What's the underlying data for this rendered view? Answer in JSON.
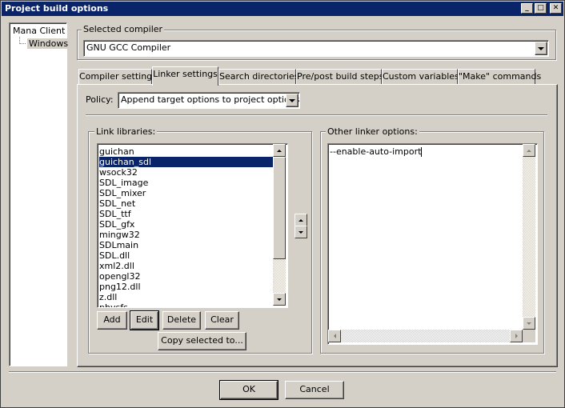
{
  "window": {
    "title": "Project build options",
    "min_label": "_",
    "max_label": "□",
    "close_label": "✕"
  },
  "tree": {
    "root": "Mana Client",
    "child": "Windows"
  },
  "compiler": {
    "group_label": "Selected compiler",
    "value": "GNU GCC Compiler"
  },
  "tabs": [
    {
      "label": "Compiler settings"
    },
    {
      "label": "Linker settings"
    },
    {
      "label": "Search directories"
    },
    {
      "label": "Pre/post build steps"
    },
    {
      "label": "Custom variables"
    },
    {
      "label": "\"Make\" commands"
    }
  ],
  "active_tab": "Linker settings",
  "policy": {
    "label": "Policy:",
    "value": "Append target options to project options"
  },
  "link_libraries": {
    "group_label": "Link libraries:",
    "items": [
      "guichan",
      "guichan_sdl",
      "wsock32",
      "SDL_image",
      "SDL_mixer",
      "SDL_net",
      "SDL_ttf",
      "SDL_gfx",
      "mingw32",
      "SDLmain",
      "SDL.dll",
      "xml2.dll",
      "opengl32",
      "png12.dll",
      "z.dll",
      "physfs"
    ],
    "selected": "guichan_sdl",
    "buttons": {
      "add": "Add",
      "edit": "Edit",
      "delete": "Delete",
      "clear": "Clear",
      "copy": "Copy selected to..."
    }
  },
  "other_linker": {
    "group_label": "Other linker options:",
    "value": "--enable-auto-import"
  },
  "footer": {
    "ok": "OK",
    "cancel": "Cancel"
  },
  "colors": {
    "titlebar": "#0a246a",
    "face": "#d4d0c8",
    "selection": "#0a246a"
  }
}
